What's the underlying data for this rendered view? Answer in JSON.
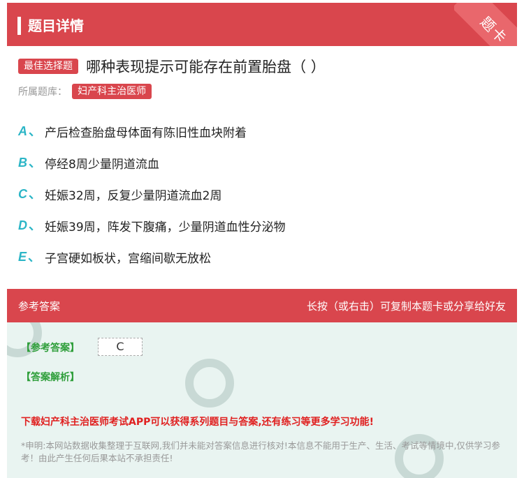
{
  "header": {
    "title": "题目详情",
    "ribbon": "题卡"
  },
  "question": {
    "type_badge": "最佳选择题",
    "text": "哪种表现提示可能存在前置胎盘（ ）",
    "library_label": "所属题库：",
    "library_badge": "妇产科主治医师"
  },
  "options": [
    {
      "letter": "A",
      "sep": "、",
      "text": "产后检查胎盘母体面有陈旧性血块附着"
    },
    {
      "letter": "B",
      "sep": "、",
      "text": "停经8周少量阴道流血"
    },
    {
      "letter": "C",
      "sep": "、",
      "text": "妊娠32周，反复少量阴道流血2周"
    },
    {
      "letter": "D",
      "sep": "、",
      "text": "妊娠39周，阵发下腹痛，少量阴道血性分泌物"
    },
    {
      "letter": "E",
      "sep": "、",
      "text": "子宫硬如板状，宫缩间歇无放松"
    }
  ],
  "answer_bar": {
    "left": "参考答案",
    "right": "长按（或右击）可复制本题卡或分享给好友"
  },
  "answer": {
    "answer_label": "【参考答案】",
    "answer_value": "C",
    "analysis_label": "【答案解析】",
    "download": "下载妇产科主治医师考试APP可以获得系列题目与答案,还有练习等更多学习功能!",
    "notice": "*申明:本网站数据收集整理于互联网,我们并未能对答案信息进行核对!本信息不能用于生产、生活、考试等情境中,仅供学习参考！由此产生任何后果本站不承担责任!"
  },
  "colors": {
    "accent": "#d9464d",
    "option_letter": "#2bb5c6",
    "answer_green": "#2e9e3a",
    "download_red": "#e02020"
  }
}
